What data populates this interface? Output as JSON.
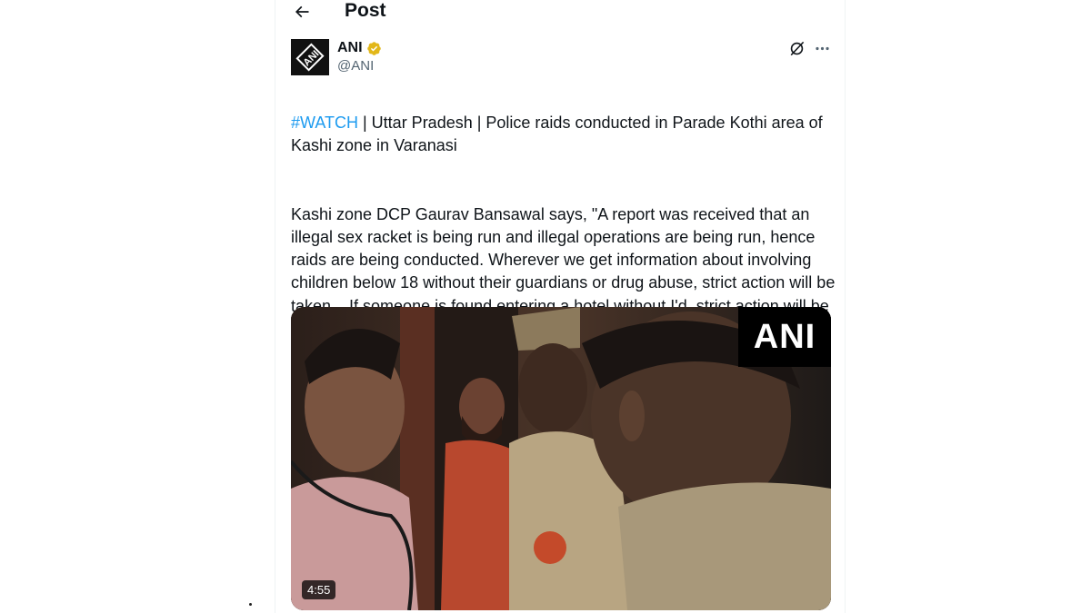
{
  "header": {
    "title": "Post",
    "back_icon": "arrow-left-icon"
  },
  "author": {
    "name": "ANI",
    "handle": "@ANI",
    "verified": true,
    "verified_color": "#e2b719",
    "avatar_text": "ANI"
  },
  "actions": {
    "grok_icon": "grok-icon",
    "more_icon": "more-horizontal-icon"
  },
  "post": {
    "hashtag": "#WATCH",
    "line1_rest": " | Uttar Pradesh | Police raids conducted in Parade Kothi area of Kashi zone in Varanasi",
    "paragraph2": "Kashi zone DCP Gaurav Bansawal says, \"A report was received that an illegal sex racket is being run and illegal operations are being run, hence raids are being conducted. Wherever we get information about involving children below 18 without their guardians or drug abuse, strict action will be taken... If someone is found entering a hotel without I'd, strict action will be taken... The nexus is being investigated...\""
  },
  "media": {
    "watermark": "ANI",
    "duration": "4:55"
  },
  "colors": {
    "link": "#1d9bf0",
    "text": "#0f1419",
    "secondary": "#536471"
  }
}
